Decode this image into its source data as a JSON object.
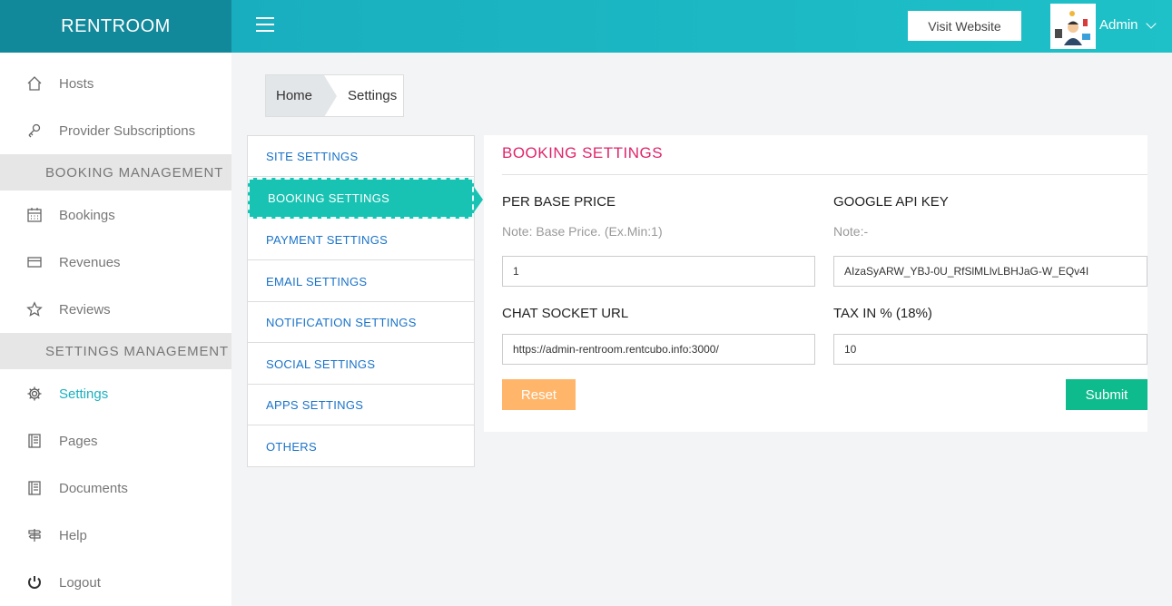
{
  "brand": "RENTROOM",
  "header": {
    "visit_label": "Visit Website",
    "user_name": "Admin"
  },
  "sidebar": {
    "items_top": [
      {
        "label": "Hosts",
        "icon": "home-icon"
      },
      {
        "label": "Provider Subscriptions",
        "icon": "key-icon"
      }
    ],
    "section_booking": "BOOKING MANAGEMENT",
    "items_booking": [
      {
        "label": "Bookings",
        "icon": "calendar-icon"
      },
      {
        "label": "Revenues",
        "icon": "credit-card-icon"
      },
      {
        "label": "Reviews",
        "icon": "star-icon"
      }
    ],
    "section_settings": "SETTINGS MANAGEMENT",
    "items_settings": [
      {
        "label": "Settings",
        "icon": "gear-icon"
      },
      {
        "label": "Pages",
        "icon": "book-icon"
      },
      {
        "label": "Documents",
        "icon": "book-icon"
      },
      {
        "label": "Help",
        "icon": "signpost-icon"
      },
      {
        "label": "Logout",
        "icon": "power-icon"
      }
    ]
  },
  "breadcrumb": {
    "home": "Home",
    "current": "Settings"
  },
  "settings_menu": [
    "SITE SETTINGS",
    "BOOKING SETTINGS",
    "PAYMENT SETTINGS",
    "EMAIL SETTINGS",
    "NOTIFICATION SETTINGS",
    "SOCIAL SETTINGS",
    "APPS SETTINGS",
    "OTHERS"
  ],
  "panel": {
    "title": "BOOKING SETTINGS",
    "base_price": {
      "label": "PER BASE PRICE",
      "note": "Note: Base Price. (Ex.Min:1)",
      "value": "1"
    },
    "google_key": {
      "label": "GOOGLE API KEY",
      "note": "Note:-",
      "value": "AIzaSyARW_YBJ-0U_RfSlMLlvLBHJaG-W_EQv4I"
    },
    "chat_url": {
      "label": "CHAT SOCKET URL",
      "value": "https://admin-rentroom.rentcubo.info:3000/"
    },
    "tax": {
      "label": "TAX IN % (18%)",
      "value": "10"
    },
    "reset_label": "Reset",
    "submit_label": "Submit"
  },
  "colors": {
    "brand_bg": "#12899b",
    "topbar": "#1ec1c8",
    "accent": "#19c3b3",
    "title": "#e0246b",
    "reset": "#ffb66b",
    "submit": "#0dbb8c"
  }
}
